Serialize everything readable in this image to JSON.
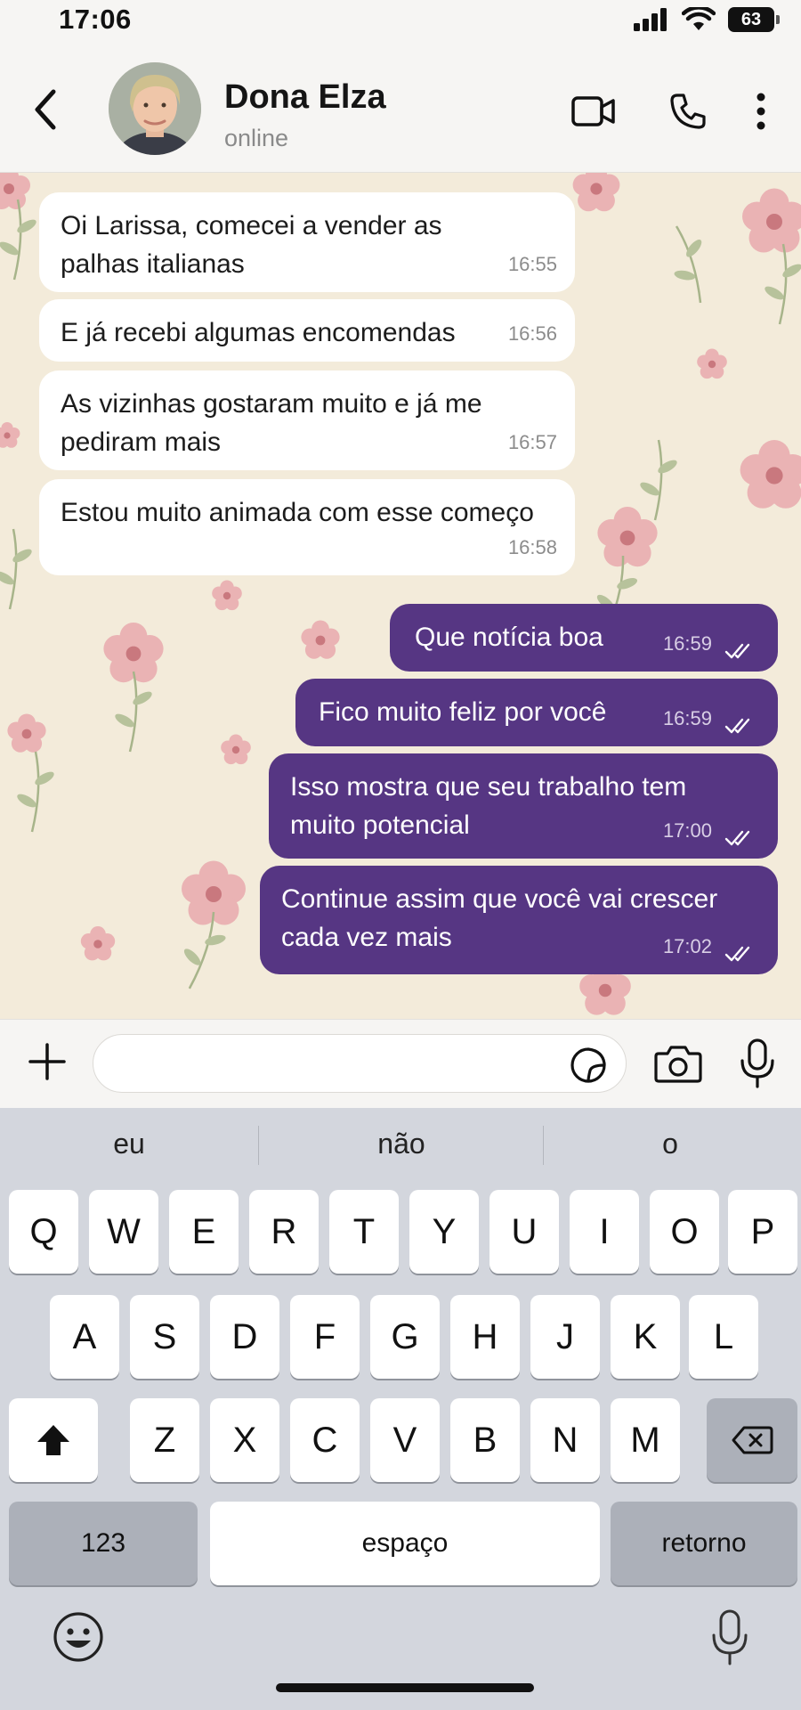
{
  "status_bar": {
    "time": "17:06",
    "battery": "63",
    "icons": [
      "signal-icon",
      "wifi-icon",
      "battery-icon"
    ]
  },
  "header": {
    "contact_name": "Dona Elza",
    "contact_status": "online",
    "icons": [
      "back-icon",
      "video-call-icon",
      "phone-icon",
      "more-icon"
    ]
  },
  "messages": [
    {
      "direction": "in",
      "text": "Oi Larissa, comecei a vender as palhas italianas",
      "time": "16:55"
    },
    {
      "direction": "in",
      "text": "E já recebi algumas encomendas",
      "time": "16:56"
    },
    {
      "direction": "in",
      "text": "As vizinhas gostaram muito e já me pediram mais",
      "time": "16:57"
    },
    {
      "direction": "in",
      "text": "Estou muito animada com esse começo",
      "time": "16:58"
    },
    {
      "direction": "out",
      "text": "Que notícia boa",
      "time": "16:59",
      "status": "read"
    },
    {
      "direction": "out",
      "text": "Fico muito feliz por você",
      "time": "16:59",
      "status": "read"
    },
    {
      "direction": "out",
      "text": "Isso mostra que seu trabalho tem muito potencial",
      "time": "17:00",
      "status": "read"
    },
    {
      "direction": "out",
      "text": "Continue assim que você vai crescer cada vez mais",
      "time": "17:02",
      "status": "read"
    }
  ],
  "input_bar": {
    "placeholder": "",
    "icons": [
      "plus-icon",
      "sticker-icon",
      "camera-icon",
      "microphone-icon"
    ]
  },
  "keyboard": {
    "suggestions": [
      "eu",
      "não",
      "o"
    ],
    "row1": [
      "Q",
      "W",
      "E",
      "R",
      "T",
      "Y",
      "U",
      "I",
      "O",
      "P"
    ],
    "row2": [
      "A",
      "S",
      "D",
      "F",
      "G",
      "H",
      "J",
      "K",
      "L"
    ],
    "row3": [
      "Z",
      "X",
      "C",
      "V",
      "B",
      "N",
      "M"
    ],
    "numbers_key": "123",
    "space_key": "espaço",
    "return_key": "retorno"
  },
  "colors": {
    "outgoing_bubble": "#563683",
    "incoming_bubble": "#ffffff",
    "wallpaper": "#f3ebda"
  }
}
